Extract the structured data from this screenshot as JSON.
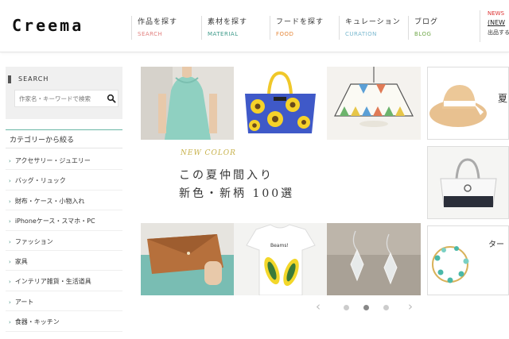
{
  "header": {
    "logo": "Creema",
    "nav": [
      {
        "ja": "作品を探す",
        "en": "SEARCH",
        "color": "#e2807f"
      },
      {
        "ja": "素材を探す",
        "en": "MATERIAL",
        "color": "#3e9a8a"
      },
      {
        "ja": "フードを探す",
        "en": "FOOD",
        "color": "#e6893c"
      },
      {
        "ja": "キュレーション",
        "en": "CURATION",
        "color": "#79b8cf"
      },
      {
        "ja": "ブログ",
        "en": "BLOG",
        "color": "#72a94c"
      }
    ],
    "news": {
      "label": "NEWS",
      "link": "(NEW",
      "sub": "出品する"
    }
  },
  "sidebar": {
    "search_title": "SEARCH",
    "search_placeholder": "作家名・キーワードで検索",
    "category_title": "カテゴリーから絞る",
    "categories": [
      "アクセサリー・ジュエリー",
      "バッグ・リュック",
      "財布・ケース・小物入れ",
      "iPhoneケース・スマホ・PC",
      "ファッション",
      "家具",
      "インテリア雑貨・生活道具",
      "アート",
      "食器・キッチン"
    ]
  },
  "hero": {
    "tag": "NEW COLOR",
    "line1": "この夏仲間入り",
    "line2": "新色・新柄 100選"
  },
  "right_col": {
    "caption1": "夏",
    "caption2": "ター"
  },
  "carousel": {
    "prev": "‹",
    "next": "›",
    "dots": 3,
    "active": 1
  },
  "colors": {
    "accent": "#6ab7a5",
    "gold": "#c7b14a"
  }
}
